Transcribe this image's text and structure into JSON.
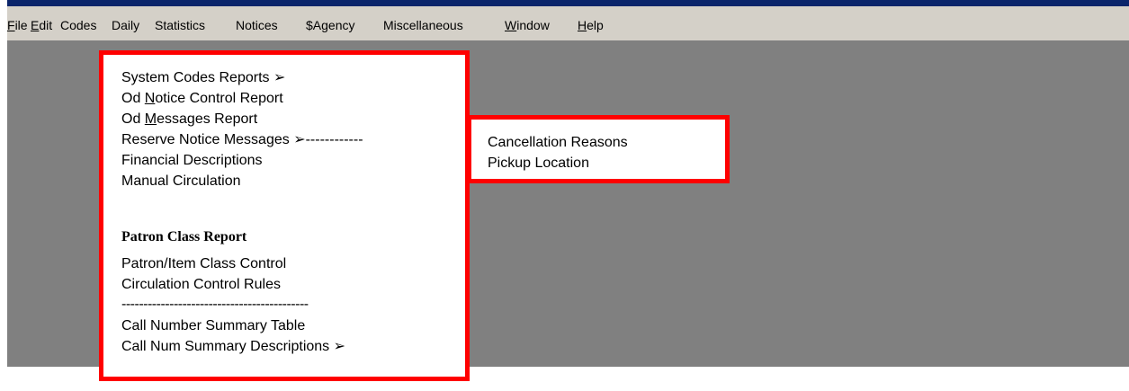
{
  "menubar": {
    "items": [
      {
        "pre": "",
        "mn": "F",
        "post": "ile"
      },
      {
        "pre": "",
        "mn": "E",
        "post": "dit"
      },
      {
        "pre": "Codes",
        "mn": "",
        "post": ""
      },
      {
        "pre": "Daily",
        "mn": "",
        "post": ""
      },
      {
        "pre": "Statistics",
        "mn": "",
        "post": ""
      },
      {
        "pre": "Notices",
        "mn": "",
        "post": ""
      },
      {
        "pre": "$Agency",
        "mn": "",
        "post": ""
      },
      {
        "pre": "Miscellaneous",
        "mn": "",
        "post": ""
      },
      {
        "pre": "",
        "mn": "W",
        "post": "indow"
      },
      {
        "pre": "",
        "mn": "H",
        "post": "elp"
      }
    ]
  },
  "codes_menu": {
    "items": [
      {
        "pre": "System Codes Reports ",
        "mn": "",
        "post": "",
        "arrow": "➢",
        "tail": ""
      },
      {
        "pre": "Od ",
        "mn": "N",
        "post": "otice Control Report",
        "arrow": "",
        "tail": ""
      },
      {
        "pre": "Od ",
        "mn": "M",
        "post": "essages Report",
        "arrow": "",
        "tail": ""
      },
      {
        "pre": "Reserve Notice Messages ",
        "mn": "",
        "post": "",
        "arrow": "➢",
        "tail": "------------"
      },
      {
        "pre": "Financial Descriptions",
        "mn": "",
        "post": "",
        "arrow": "",
        "tail": ""
      },
      {
        "pre": "Manual Circulation",
        "mn": "",
        "post": "",
        "arrow": "",
        "tail": ""
      }
    ],
    "section_heading": "Patron Class Report",
    "items2": [
      {
        "label": "Patron/Item Class Control"
      },
      {
        "label": "Circulation Control Rules"
      }
    ],
    "separator": "-------------------------------------------",
    "items3": [
      {
        "pre": "Call Number Summary Table",
        "arrow": ""
      },
      {
        "pre": "Call Num Summary Descriptions ",
        "arrow": "➢"
      }
    ]
  },
  "reserve_submenu": {
    "items": [
      {
        "label": "Cancellation Reasons"
      },
      {
        "label": "Pickup Location"
      }
    ]
  }
}
